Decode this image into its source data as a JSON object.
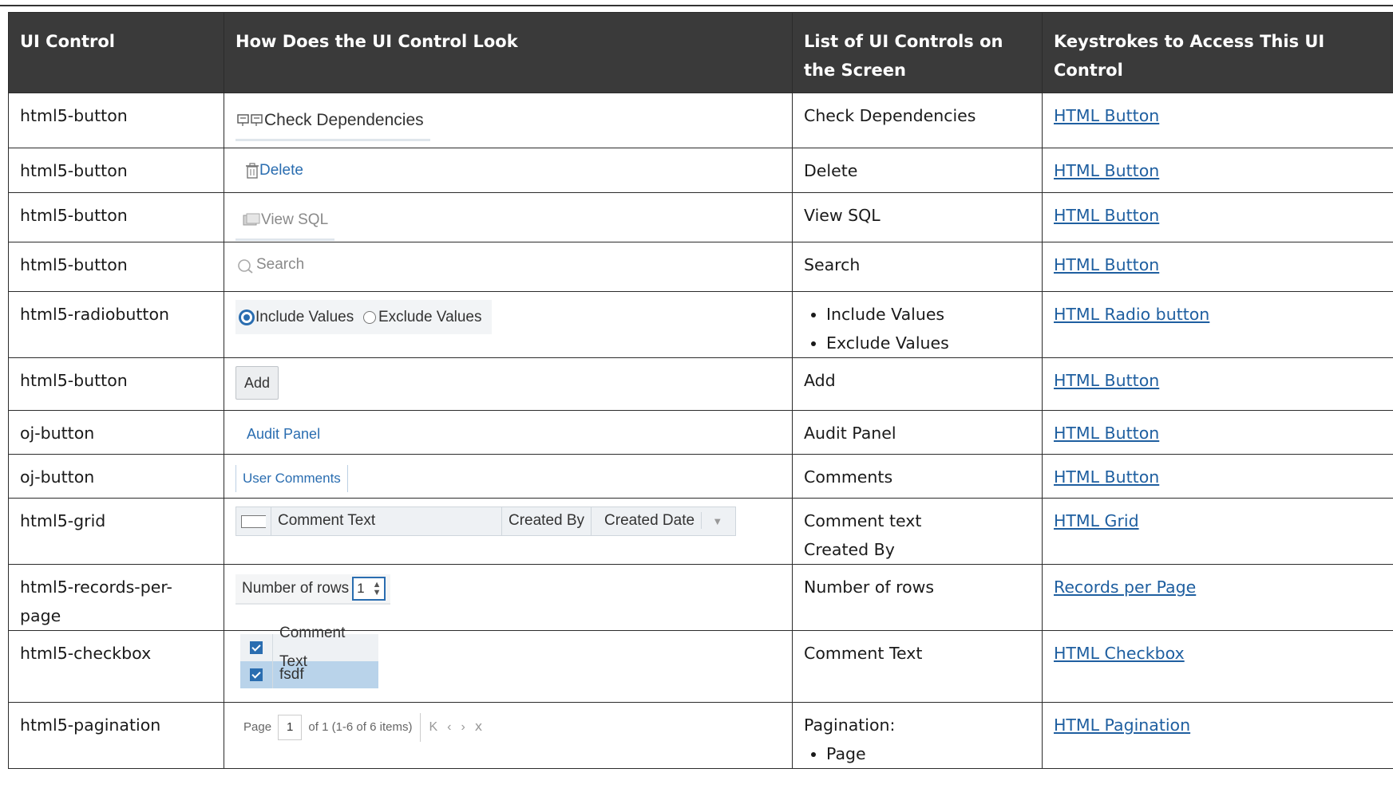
{
  "headers": {
    "control": "UI Control",
    "look": "How Does the UI Control Look",
    "list": "List of UI Controls on the Screen",
    "keys": "Keystrokes to Access This UI Control"
  },
  "rows": [
    {
      "control": "html5-button",
      "look": {
        "label": "Check Dependencies",
        "icon": "dependencies-icon"
      },
      "list": "Check Dependencies",
      "link": "HTML Button"
    },
    {
      "control": "html5-button",
      "look": {
        "label": "Delete",
        "icon": "trash-icon"
      },
      "list": "Delete",
      "link": "HTML Button"
    },
    {
      "control": "html5-button",
      "look": {
        "label": "View SQL",
        "icon": "sql-icon"
      },
      "list": "View SQL",
      "link": "HTML Button"
    },
    {
      "control": "html5-button",
      "look": {
        "label": "Search",
        "icon": "search-icon"
      },
      "list": "Search",
      "link": "HTML Button"
    },
    {
      "control": "html5-radiobutton",
      "look": {
        "opt1": "Include Values",
        "opt2": "Exclude Values",
        "selected": "Include Values"
      },
      "list_items": [
        "Include Values",
        "Exclude Values"
      ],
      "link": "HTML Radio button"
    },
    {
      "control": "html5-button",
      "look": {
        "label": "Add"
      },
      "list": "Add",
      "link": "HTML Button"
    },
    {
      "control": "oj-button",
      "look": {
        "label": "Audit Panel"
      },
      "list": "Audit Panel",
      "link": "HTML Button"
    },
    {
      "control": "oj-button",
      "look": {
        "label": "User Comments"
      },
      "list": "Comments",
      "link": "HTML Button"
    },
    {
      "control": "html5-grid",
      "look": {
        "col1": "Comment Text",
        "col2": "Created By",
        "col3": "Created Date"
      },
      "list_lines": [
        "Comment text",
        "Created By"
      ],
      "link": "HTML Grid"
    },
    {
      "control": "html5-records-per-page",
      "look": {
        "label": "Number of rows",
        "value": "1"
      },
      "list": "Number of rows",
      "link": "Records per Page"
    },
    {
      "control": "html5-checkbox",
      "look": {
        "header": "Comment Text",
        "row": "fsdf"
      },
      "list": "Comment Text",
      "link": "HTML Checkbox"
    },
    {
      "control": "html5-pagination",
      "look": {
        "page_label": "Page",
        "page_value": "1",
        "info": "of 1 (1-6 of 6 items)"
      },
      "list": "Pagination:",
      "list_items": [
        "Page"
      ],
      "link": "HTML Pagination"
    }
  ],
  "colors": {
    "header_bg": "#3a3a3a",
    "link": "#1f5fa0",
    "accent": "#2a6db0"
  }
}
